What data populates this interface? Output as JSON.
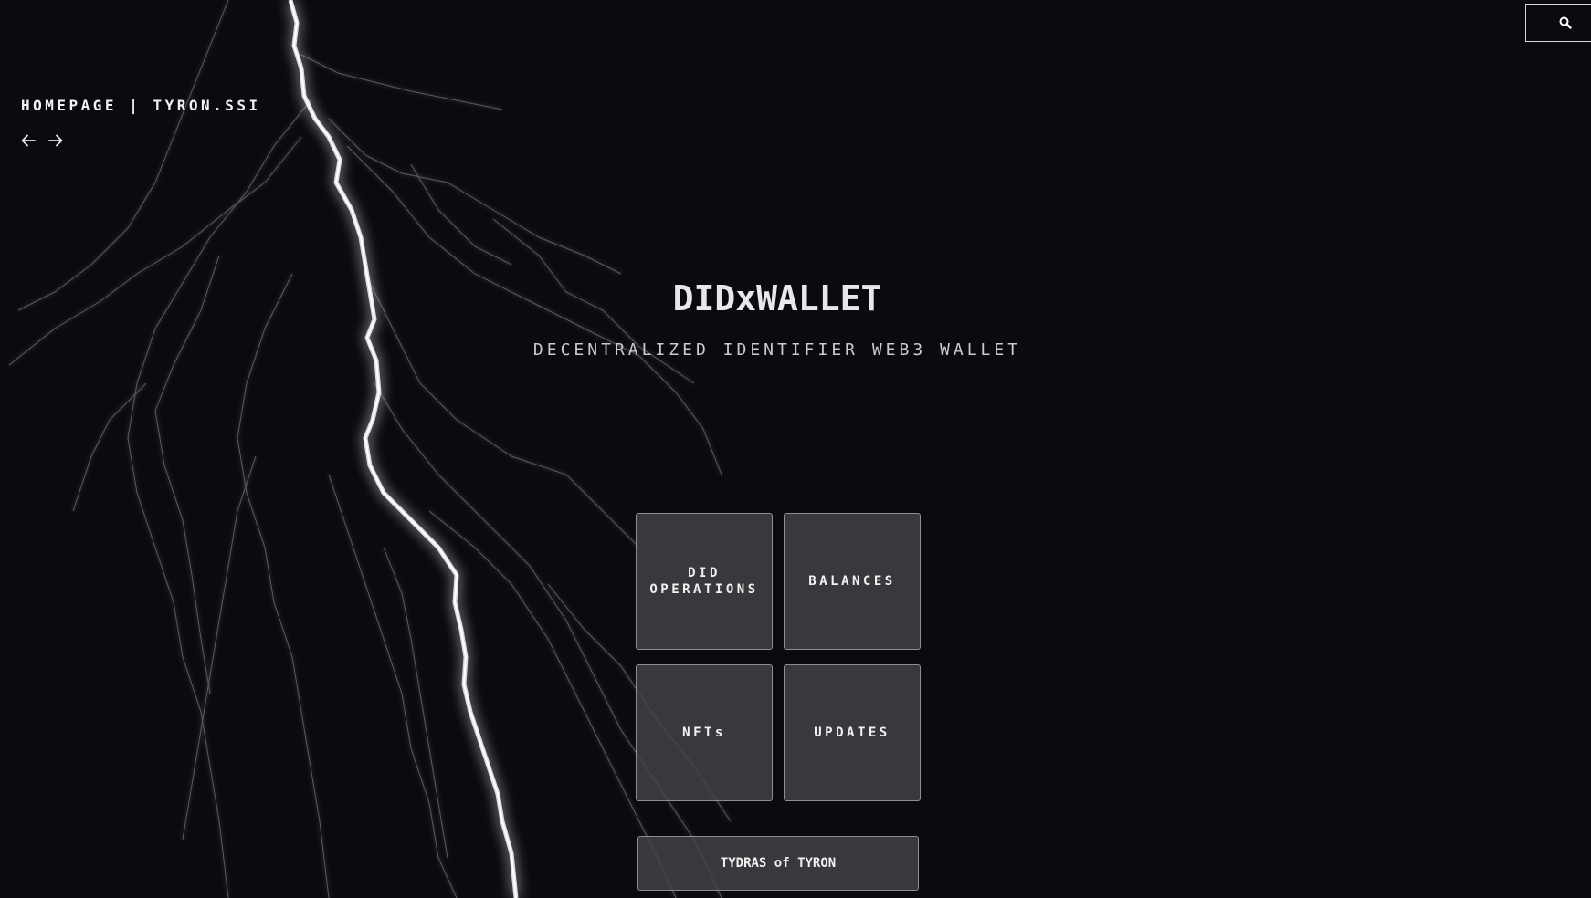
{
  "header": {
    "breadcrumb": "HOMEPAGE | TYRON.SSI",
    "search_icon": "search-icon",
    "back_icon": "arrow-left-icon",
    "forward_icon": "arrow-right-icon"
  },
  "hero": {
    "title": "DIDxWALLET",
    "subtitle": "DECENTRALIZED IDENTIFIER WEB3 WALLET"
  },
  "menu": {
    "did_operations_line1": "DID",
    "did_operations_line2": "OPERATIONS",
    "balances": "BALANCES",
    "nfts": "NFTs",
    "updates": "UPDATES",
    "tydras": "TYDRAS of TYRON"
  },
  "theme": {
    "background": "#0a0b0f",
    "tile_background": "#424347",
    "tile_border": "#8d8e92",
    "lightning": "#e8e6f2"
  }
}
